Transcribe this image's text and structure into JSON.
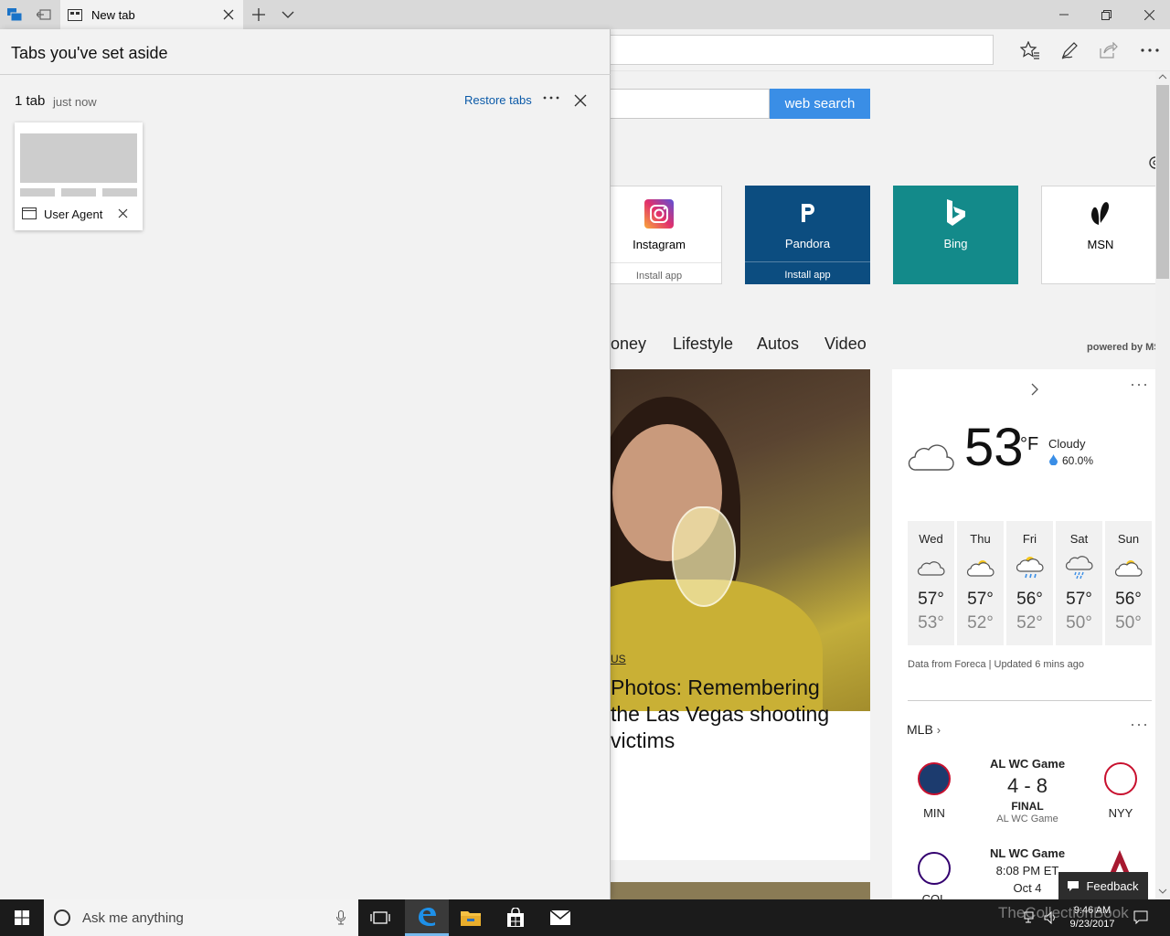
{
  "window": {
    "tab_title": "New tab"
  },
  "search": {
    "button_label": "web search"
  },
  "tiles": [
    {
      "name": "Instagram",
      "sub": "Install app",
      "icon": "instagram-icon"
    },
    {
      "name": "Pandora",
      "sub": "Install app",
      "icon": "pandora-icon"
    },
    {
      "name": "Bing",
      "sub": "",
      "icon": "bing-icon"
    },
    {
      "name": "MSN",
      "sub": "",
      "icon": "msn-icon"
    }
  ],
  "nav_categories": [
    "oney",
    "Lifestyle",
    "Autos",
    "Video"
  ],
  "powered_by": "powered by MS",
  "news": {
    "source": "US",
    "headline": "Photos: Remembering the Las Vegas shooting victims"
  },
  "weather": {
    "temp": "53",
    "unit": "°F",
    "condition": "Cloudy",
    "humidity": "60.0%",
    "forecast": [
      {
        "day": "Wed",
        "hi": "57°",
        "lo": "53°"
      },
      {
        "day": "Thu",
        "hi": "57°",
        "lo": "52°"
      },
      {
        "day": "Fri",
        "hi": "56°",
        "lo": "52°"
      },
      {
        "day": "Sat",
        "hi": "57°",
        "lo": "50°"
      },
      {
        "day": "Sun",
        "hi": "56°",
        "lo": "50°"
      }
    ],
    "credit": "Data from Foreca | Updated 6 mins ago"
  },
  "mlb": {
    "title": "MLB",
    "game1": {
      "label": "AL WC Game",
      "score": "4 - 8",
      "status": "FINAL",
      "sub": "AL WC Game",
      "home": "MIN",
      "away": "NYY"
    },
    "game2": {
      "label": "NL WC Game",
      "time": "8:08 PM ET",
      "date": "Oct 4",
      "home": "COL"
    }
  },
  "aside": {
    "title": "Tabs you've set aside",
    "count": "1 tab",
    "time": "just now",
    "restore": "Restore tabs",
    "tab_title": "User Agent"
  },
  "taskbar": {
    "search_placeholder": "Ask me anything",
    "time": "9:46 AM",
    "date": "9/23/2017"
  },
  "feedback": "Feedback",
  "watermark": "TheCollectionBook",
  "colors": {
    "accent": "#3a8ee6",
    "pandora": "#0c4d80",
    "bing": "#138a8a",
    "link": "#0b5aa8"
  }
}
